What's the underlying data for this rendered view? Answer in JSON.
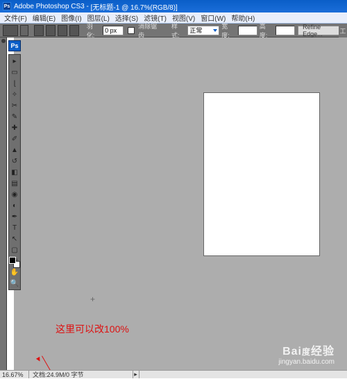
{
  "titlebar": {
    "app": "Adobe Photoshop CS3",
    "doc": "[无标题-1 @ 16.7%(RGB/8)]"
  },
  "menubar": {
    "items": [
      "文件(F)",
      "编辑(E)",
      "图像(I)",
      "图层(L)",
      "选择(S)",
      "滤镜(T)",
      "视图(V)",
      "窗口(W)",
      "帮助(H)"
    ]
  },
  "optionbar": {
    "feather_label": "羽化:",
    "feather_value": "0 px",
    "antialias_label": "消除锯齿",
    "style_label": "样式:",
    "style_value": "正常",
    "width_label": "宽度:",
    "height_label": "高度:",
    "refine_label": "Refine Edge..."
  },
  "status": {
    "zoom": "16.67%",
    "doc_info": "文档:24.9M/0 字节"
  },
  "annotation": "这里可以改100%",
  "watermark": {
    "brand": "Baidu经验",
    "url": "jingyan.baidu.com"
  },
  "right_label": "工",
  "ps": "Ps"
}
